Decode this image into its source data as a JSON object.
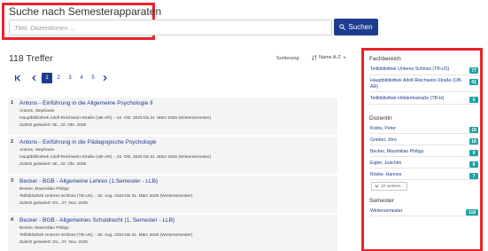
{
  "search": {
    "title": "Suche nach Semesterapparaten",
    "placeholder": "Titel, Dozentinnen ...",
    "button_label": "Suchen"
  },
  "results_summary": {
    "hits": "118 Treffer",
    "sort_label": "Sortierung:",
    "sort_value": "Name A-Z"
  },
  "pagination": {
    "pages": [
      "1",
      "2",
      "3",
      "4",
      "5"
    ],
    "active": "1"
  },
  "results": [
    {
      "number": "1",
      "title": "Antons - Einführung in die Allgemeine Psychologie II",
      "person": "Antons, Stephanie",
      "location": "Hauptbibliothek Adolf-Reichwein-Straße (UB-AR). - 22. Okt. 2025 bis 31. März 2026 (Wintersemester)",
      "modified": "Zuletzt geändert: Mi., 22. Okt. 2025"
    },
    {
      "number": "2",
      "title": "Antons - Einführung in die Pädagogische Psychologie",
      "person": "Antons, Stephanie",
      "location": "Hauptbibliothek Adolf-Reichwein-Straße (UB-AR). - 22. Okt. 2025 bis 31. März 2026 (Wintersemester)",
      "modified": "Zuletzt geändert: Mi., 22. Okt. 2025"
    },
    {
      "number": "3",
      "title": "Becker - BGB - Allgemeine Lehren (1.Semester - LLB)",
      "person": "Becker, Maximilian Philipp",
      "location": "Teilbibliothek Unteres Schloss (TB-US). - 25. Aug. 2023 bis 31. März 2026 (Wintersemester)",
      "modified": "Zuletzt geändert: Do., 27. Nov. 2025"
    },
    {
      "number": "4",
      "title": "Becker - BGB - Allgemeines Schuldrecht (1. Semester - LLB)",
      "person": "Becker, Maximilian Philipp",
      "location": "Teilbibliothek Unteres Schloss (TB-US). - 25. Aug. 2023 bis 31. März 2026 (Wintersemester)",
      "modified": "Zuletzt geändert: Do., 27. Nov. 2025"
    }
  ],
  "facets": {
    "fachbereich": {
      "heading": "Fachbereich",
      "items": [
        {
          "label": "Teilbibliothek Unteres Schloss (TB-US)",
          "count": "77"
        },
        {
          "label": "Hauptbibliothek Adolf-Reichwein-Straße (UB-AR)",
          "count": "41"
        },
        {
          "label": "Teilbibliothek Hölderlinstraße (TB-H)",
          "count": "5"
        }
      ]
    },
    "dozentin": {
      "heading": "Dozentin",
      "items": [
        {
          "label": "Krebs, Peter",
          "count": "19"
        },
        {
          "label": "Griebel, Jörn",
          "count": "18"
        },
        {
          "label": "Becker, Maximilian Philipp",
          "count": "9"
        },
        {
          "label": "Eigler, Joachim",
          "count": "8"
        },
        {
          "label": "Rösler, Hannes",
          "count": "7"
        }
      ],
      "more_label": "32 weitere..."
    },
    "semester": {
      "heading": "Semester",
      "items": [
        {
          "label": "Wintersemester",
          "count": "118"
        }
      ]
    }
  },
  "colors": {
    "primary": "#1c3c8f",
    "badge": "#1fa2a5",
    "highlight": "#e8232a",
    "row_bg": "#f4f4f4"
  },
  "icons": [
    "search-icon",
    "sort-icon",
    "chevron-down-icon",
    "first-page-icon",
    "previous-page-icon",
    "next-page-icon"
  ]
}
